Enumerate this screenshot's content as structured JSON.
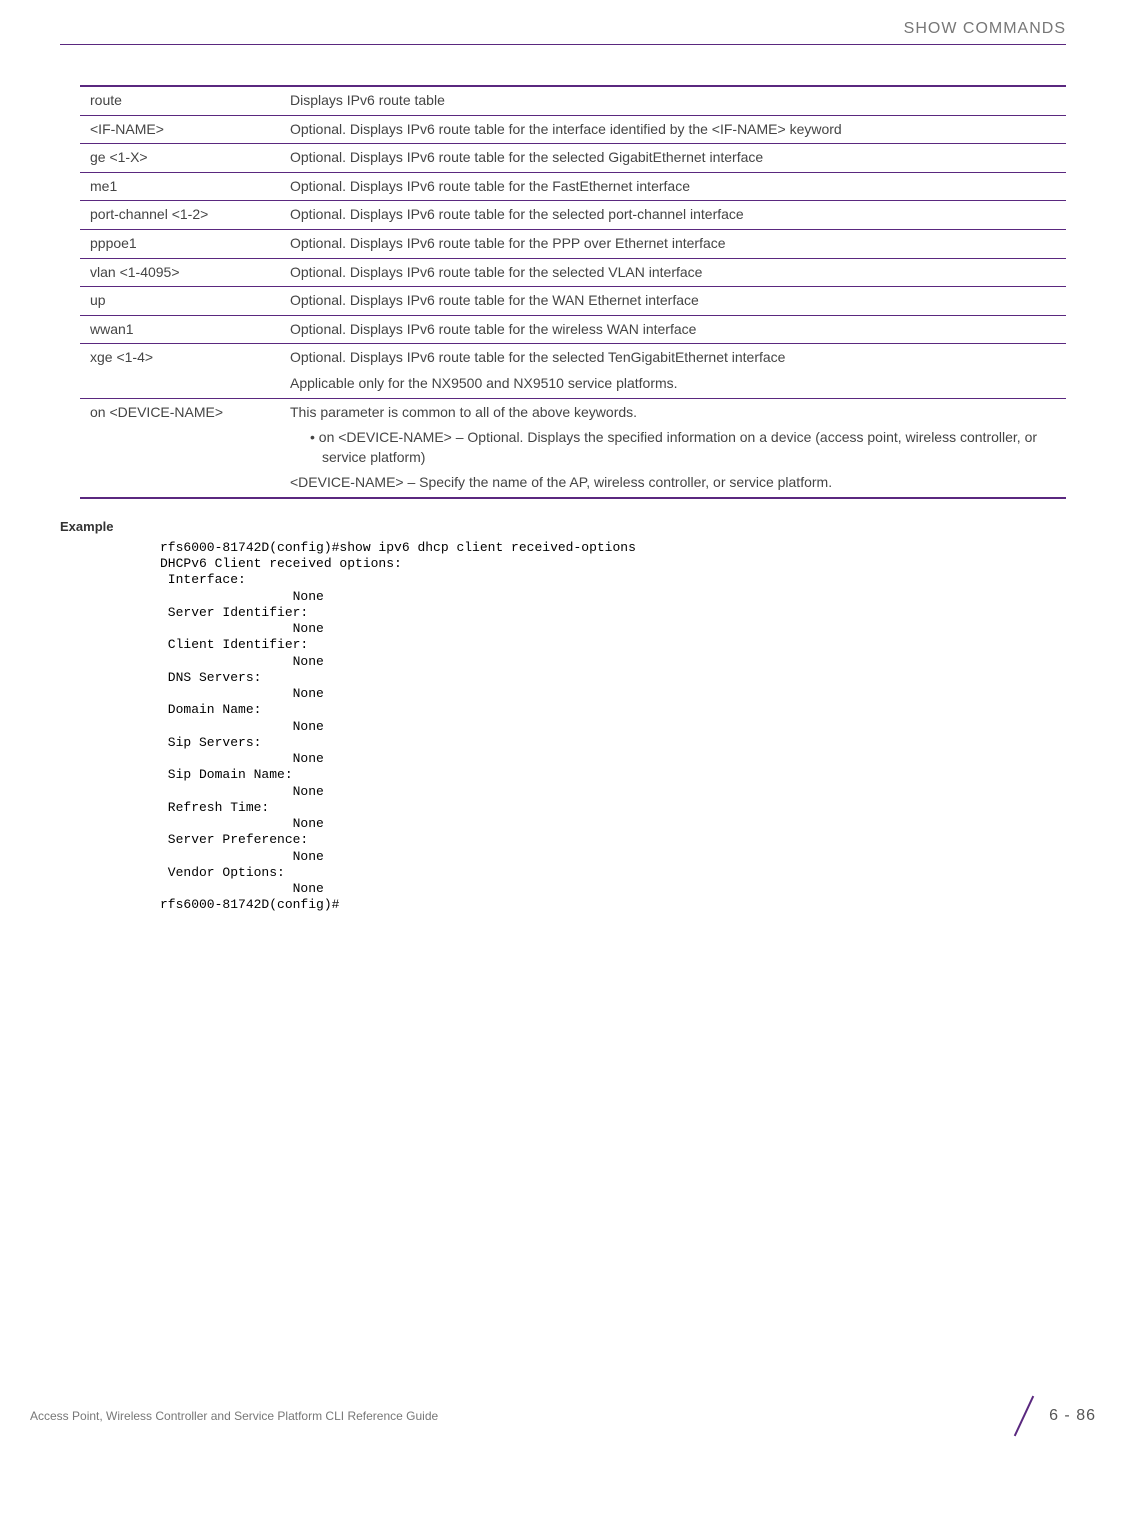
{
  "header": {
    "section": "SHOW COMMANDS"
  },
  "table": {
    "rows": [
      {
        "param": "route",
        "desc": "Displays IPv6 route table"
      },
      {
        "param": "<IF-NAME>",
        "desc": "Optional. Displays IPv6 route table for the interface identified by the <IF-NAME> keyword"
      },
      {
        "param": "ge <1-X>",
        "desc": "Optional. Displays IPv6 route table for the selected GigabitEthernet interface"
      },
      {
        "param": "me1",
        "desc": "Optional. Displays IPv6 route table for the FastEthernet interface"
      },
      {
        "param": "port-channel <1-2>",
        "desc": "Optional. Displays IPv6 route table for the selected port-channel interface"
      },
      {
        "param": "pppoe1",
        "desc": "Optional. Displays IPv6 route table for the PPP over Ethernet interface"
      },
      {
        "param": "vlan <1-4095>",
        "desc": "Optional. Displays IPv6 route table for the selected VLAN interface"
      },
      {
        "param": "up",
        "desc": "Optional. Displays IPv6 route table for the WAN Ethernet interface"
      },
      {
        "param": "wwan1",
        "desc": "Optional. Displays IPv6 route table for the wireless WAN interface"
      }
    ],
    "xge": {
      "param": "xge <1-4>",
      "line1": "Optional. Displays IPv6 route table for the selected TenGigabitEthernet interface",
      "line2": "Applicable only for the NX9500 and NX9510 service platforms."
    },
    "ondev": {
      "param": "on <DEVICE-NAME>",
      "line1": "This parameter is common to all of the above keywords.",
      "bullet": "on <DEVICE-NAME> – Optional. Displays the specified information on a device (access point, wireless controller, or service platform)",
      "line2": "<DEVICE-NAME> – Specify the name of the AP, wireless controller, or service platform."
    }
  },
  "example": {
    "heading": "Example",
    "code": "rfs6000-81742D(config)#show ipv6 dhcp client received-options\nDHCPv6 Client received options:\n Interface:\n                 None\n Server Identifier:\n                 None\n Client Identifier:\n                 None\n DNS Servers:\n                 None\n Domain Name:\n                 None\n Sip Servers:\n                 None\n Sip Domain Name:\n                 None\n Refresh Time:\n                 None\n Server Preference:\n                 None\n Vendor Options:\n                 None\nrfs6000-81742D(config)#"
  },
  "footer": {
    "doc_title": "Access Point, Wireless Controller and Service Platform CLI Reference Guide",
    "page_number": "6 - 86"
  }
}
